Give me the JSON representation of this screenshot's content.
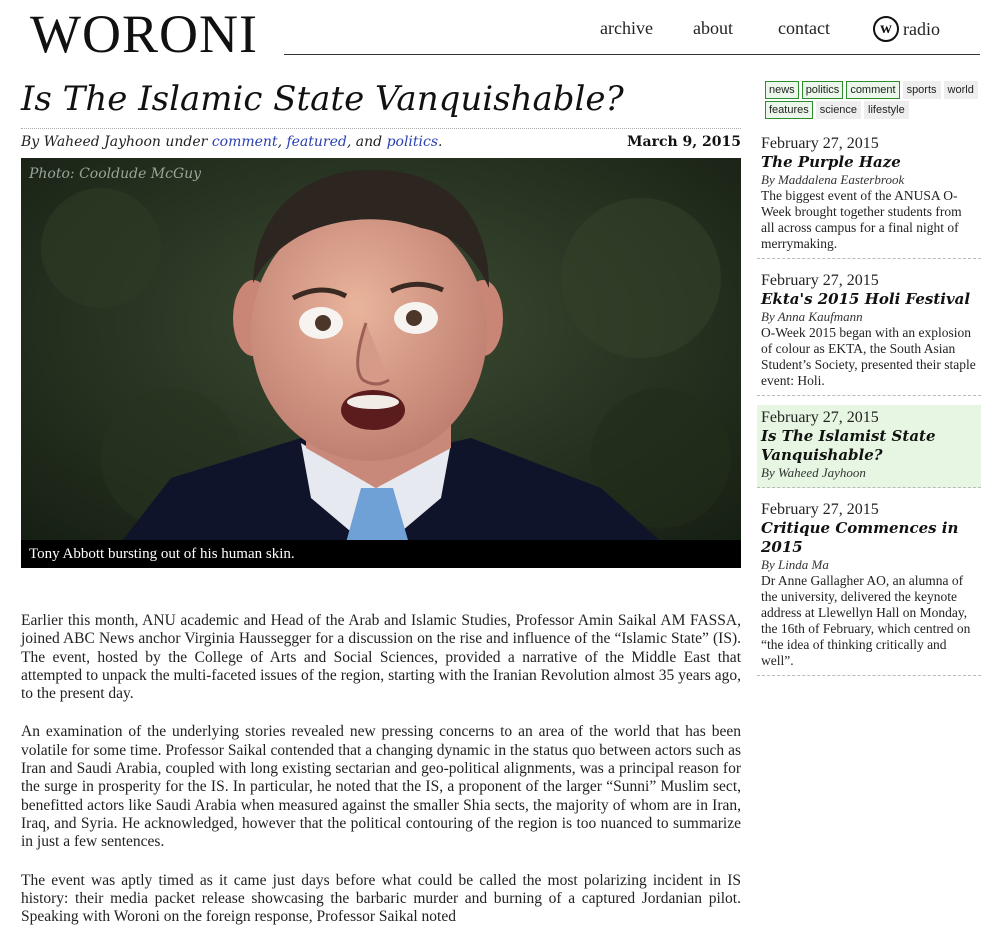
{
  "site": {
    "logo": "WORONI",
    "nav": {
      "archive": "archive",
      "about": "about",
      "contact": "contact",
      "radio_logo": "w",
      "radio": "radio"
    }
  },
  "article": {
    "title": "Is The Islamic State Vanquishable?",
    "byline": {
      "prefix": "By Waheed Jayhoon under",
      "cat1": "comment",
      "sep1": ",",
      "cat2": "featured",
      "sep2": ", and",
      "cat3": "politics",
      "end": "."
    },
    "date": "March 9, 2015",
    "photo_credit": "Photo: Cooldude McGuy",
    "caption": "Tony Abbott bursting out of his human skin.",
    "paragraphs": [
      "Earlier this month, ANU academic and Head of the Arab and Islamic Studies, Professor Amin Saikal AM FASSA, joined ABC News anchor Virginia Haussegger for a discussion on the rise and influence of the “Islamic State” (IS). The event, hosted by the College of Arts and Social Sciences, provided a narrative of the Middle East that attempted to unpack the multi-faceted issues of the region, starting with the Iranian Revolution almost 35 years ago, to the present day.",
      "An examination of the underlying stories revealed new pressing concerns to an area of the world that has been volatile for some time. Professor Saikal contended that a changing dynamic in the status quo between actors such as Iran and Saudi Arabia, coupled with long existing sectarian and geo-political alignments, was a principal reason for the surge in prosperity for the IS. In particular, he noted that the IS, a proponent of the larger “Sunni” Muslim sect, benefitted actors like Saudi Arabia when measured against the smaller Shia sects, the majority of whom are in Iran, Iraq, and Syria. He acknowledged, however that the political contouring of the region is too nuanced to summarize in just a few sentences.",
      "The event was aptly timed as it came just days before what could be called the most polarizing incident in IS history: their media packet release showcasing the barbaric murder and burning of a captured Jordanian pilot. Speaking with Woroni on the foreign response, Professor Saikal noted"
    ]
  },
  "sidebar": {
    "tags": [
      {
        "label": "news",
        "highlight": true
      },
      {
        "label": "politics",
        "highlight": true
      },
      {
        "label": "comment",
        "highlight": true
      },
      {
        "label": "sports",
        "highlight": false
      },
      {
        "label": "world",
        "highlight": false
      },
      {
        "label": "features",
        "highlight": true
      },
      {
        "label": "science",
        "highlight": false
      },
      {
        "label": "lifestyle",
        "highlight": false
      }
    ],
    "items": [
      {
        "date": "February 27, 2015",
        "title": "The Purple Haze",
        "author": "By Maddalena Easterbrook",
        "excerpt": "The biggest event of the ANUSA O-Week brought together students from all across campus for a final night of merrymaking."
      },
      {
        "date": "February 27, 2015",
        "title": "Ekta's 2015 Holi Festival",
        "author": "By Anna Kaufmann",
        "excerpt": "O-Week 2015 began with an explosion of colour as EKTA, the South Asian Student’s Society, presented their staple event: Holi."
      },
      {
        "date": "February 27, 2015",
        "title": "Is The Islamist State Vanquishable?",
        "author": "By Waheed Jayhoon",
        "excerpt": ""
      },
      {
        "date": "February 27, 2015",
        "title": "Critique Commences in 2015",
        "author": "By Linda Ma",
        "excerpt": "Dr Anne Gallagher AO, an alumna of the university, delivered the keynote address at Llewellyn Hall on Monday, the 16th of February, which centred on “the idea of thinking critically and well”."
      }
    ]
  }
}
